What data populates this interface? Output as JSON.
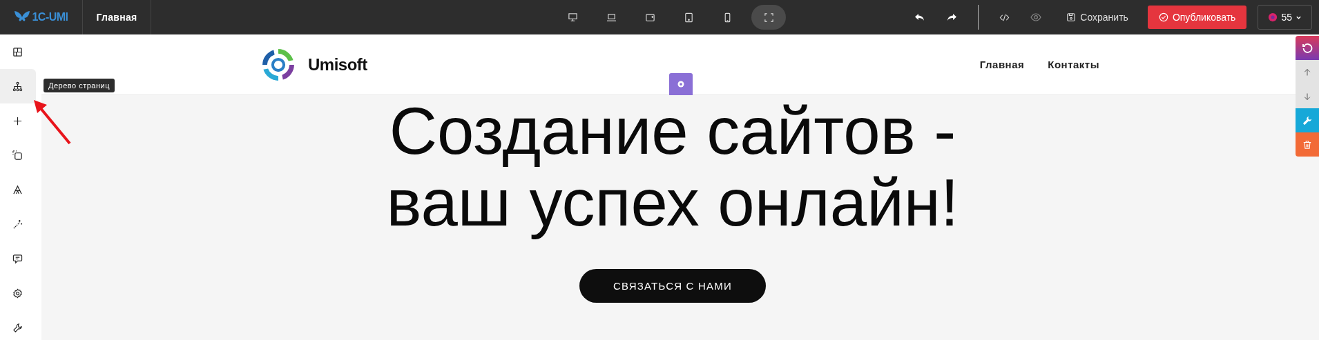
{
  "topbar": {
    "logo": "1C-UMI",
    "page": "Главная",
    "devices": [
      {
        "kind": "desktop",
        "selected": false
      },
      {
        "kind": "laptop",
        "selected": false
      },
      {
        "kind": "tablet-landscape",
        "selected": false
      },
      {
        "kind": "tablet",
        "selected": false
      },
      {
        "kind": "phone",
        "selected": false
      },
      {
        "kind": "fullscreen",
        "selected": true
      }
    ],
    "save": "Сохранить",
    "publish": "Опубликовать",
    "account": "55"
  },
  "sidebar": {
    "items": [
      {
        "kind": "blocks",
        "selected": false
      },
      {
        "kind": "tree",
        "selected": true
      },
      {
        "kind": "add",
        "selected": false
      },
      {
        "kind": "shape",
        "selected": false
      },
      {
        "kind": "font",
        "selected": false
      },
      {
        "kind": "magic",
        "selected": false
      },
      {
        "kind": "chat",
        "selected": false
      },
      {
        "kind": "settings",
        "selected": false
      },
      {
        "kind": "tools",
        "selected": false
      }
    ],
    "tooltip": "Дерево страниц"
  },
  "site": {
    "brand": "Umisoft",
    "nav": [
      {
        "label": "Главная"
      },
      {
        "label": "Контакты"
      }
    ],
    "hero": {
      "title_lines": [
        "Создание сайтов -",
        "ваш успех онлайн!"
      ],
      "button": "СВЯЗАТЬСЯ С НАМИ"
    }
  }
}
